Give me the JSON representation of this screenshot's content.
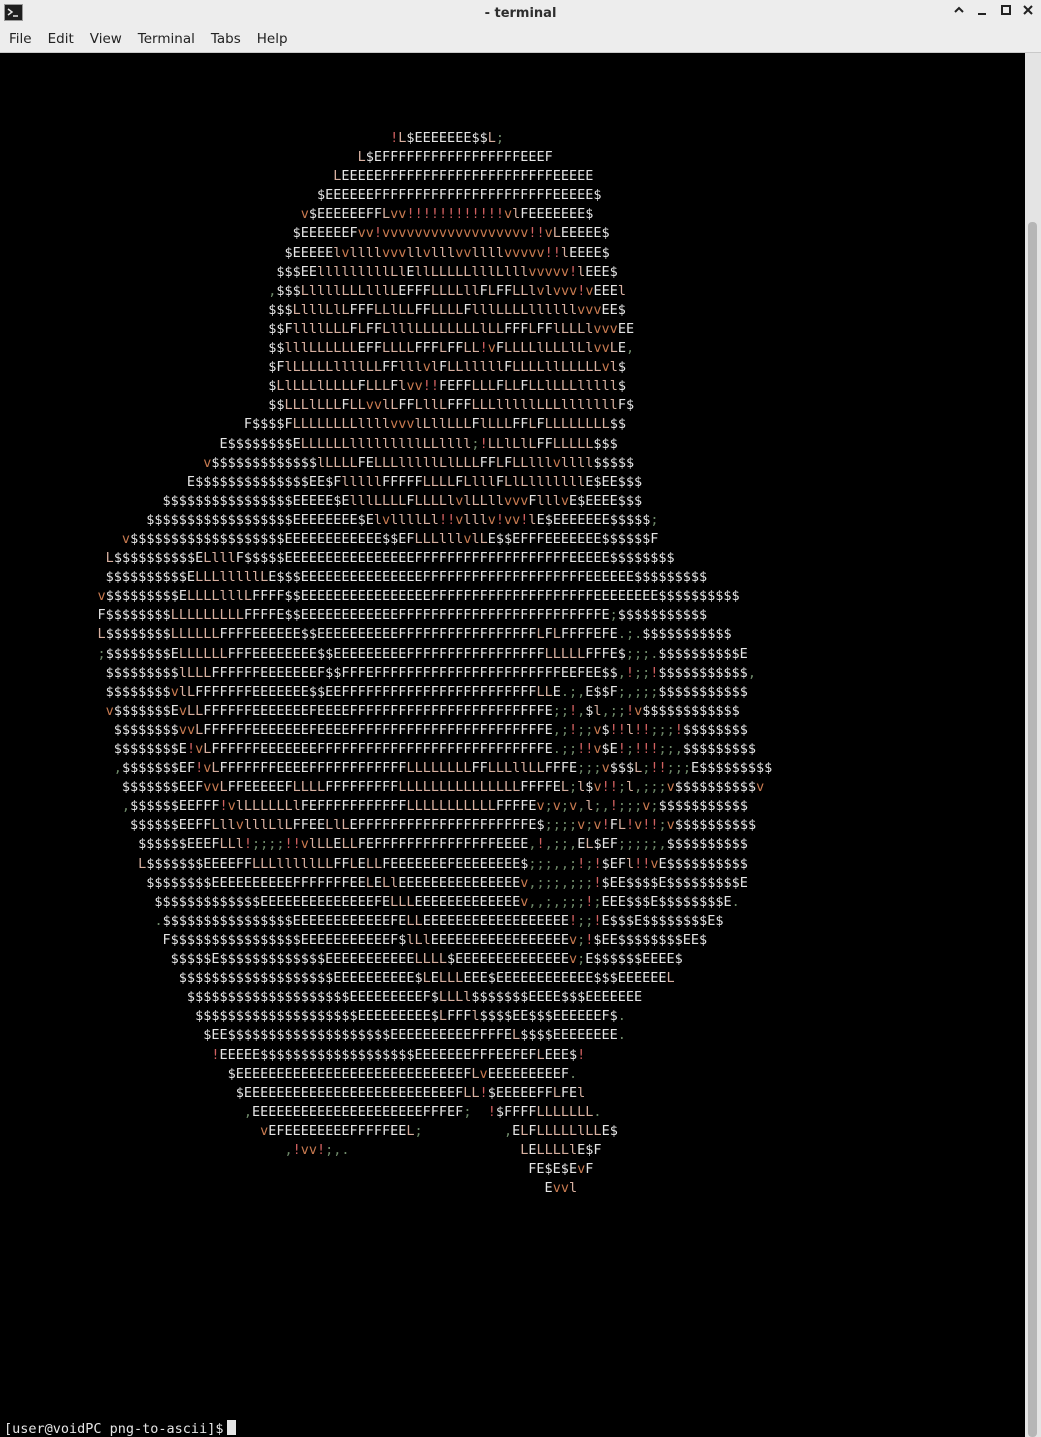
{
  "window": {
    "title": "- terminal"
  },
  "icons": {
    "app": "terminal-icon",
    "minimize": "chevron-up-icon",
    "restore": "minus-icon",
    "maximize": "square-icon",
    "close": "close-icon"
  },
  "menubar": [
    {
      "label": "File"
    },
    {
      "label": "Edit"
    },
    {
      "label": "View"
    },
    {
      "label": "Terminal"
    },
    {
      "label": "Tabs"
    },
    {
      "label": "Help"
    }
  ],
  "terminal": {
    "prompt": "[user@voidPC png-to-ascii]$",
    "art_lines": [
      "                                                !L$EEEEEEE$$L;",
      "                                            L$EFFFFFFFFFFFFFFFFFEEEF",
      "                                         LEEEEEFFFFFFFFFFFFFFFFFFFFFEEEEE",
      "                                       $EEEEEEFFFFFFFFFFFFFFFFFFFFFFEEEEE$",
      "                                     v$EEEEEEFFLvv!!!!!!!!!!!!vlFEEEEEEE$",
      "                                    $EEEEEEFvv!vvvvvvvvvvvvvvvvvv!!vLEEEEE$",
      "                                   $EEEEElvllllvvvllvlllvvllllvvvvv!!lEEEE$",
      "                                  $$$EElllllllllLlEllLLLLLlllLlllvvvvv!lEEE$",
      "                                 ,$$$LllllLLLlllLEFFFLLLLllFLFFLLlvlvvv!vEEEl",
      "                                 $$$LlllLlLFFFLLlLLFFLLLLFlllLLLLllllllvvvEE$",
      "                                 $$FllllLLLFLFFLlllLLLLLLLLlLLFFFLFFlLLLlvvvEE",
      "                                 $$lllLLLLLLEFFLLLLFFFLFFLL!vFLLLLlLLLlLlvvLE,",
      "                                 $FlLLLLLllllLLFFlllvlFLLlllllFLLLLllLLLLLvl$",
      "                                 $LlLLLlLLLLFLLLFlvv!!FEFFLLLFLLFLLlLLLlllll$",
      "                                 $$LLLlLLLFLLvvlLFFLllLFFFLLLlllllLLLlllllllF$",
      "                              F$$$$FLLLLLLLLllllvvvlLllLLLFlLLLFFLFLLLLLLLL$$",
      "                           E$$$$$$$$ELLLLLLlllllllllLLllll;!LLlLlLFFLLLLL$$$",
      "                         v$$$$$$$$$$$$$lLLLLFELLLlllllLlLLLFFLFLLlllvllll$$$$$",
      "                       E$$$$$$$$$$$$$$EE$FlllllFFFFFLLLLFLlllFLlLlllllllE$EE$$$",
      "                    $$$$$$$$$$$$$$$$EEEEE$ElllLLLLFLLLLlvlLLllvvvFlllvE$EEEE$$$",
      "                  $$$$$$$$$$$$$$$$$$EEEEEEEE$ElvllllLl!!vlllv!vv!lE$EEEEEEE$$$$$;",
      "               v$$$$$$$$$$$$$$$$$$$EEEEEEEEEEEE$$EFLLLlllvlLE$$EFFFEEEEEEE$$$$$$F",
      "             L$$$$$$$$$$ELlllF$$$$$EEEEEEEEEEEEEEEEFFFFFFFFFFFFFFFFFFFEEEEE$$$$$$$$",
      "             $$$$$$$$$$ELLLlllllLE$$$EEEEEEEEEEEEEEEFFFFFFFFFFFFFFFFFFFFEEEEEE$$$$$$$$$",
      "            v$$$$$$$$$ELLLLlllLFFFF$$EEEEEEEEEEEEEEEEFFFFFFFFFFFFFFFFFFFFEEEEEEEE$$$$$$$$$$",
      "            F$$$$$$$$LLLLLLLLLFFFFE$$EEEEEEEEEEEEFFFFFFFFFFFFFFFFFFFFFFFFFE;$$$$$$$$$$$",
      "            L$$$$$$$$LLLLLLFFFFEEEEEE$$EEEEEEEEEEFFFFFFFFFFFFFFFFFLFLFFFFEFE.;.$$$$$$$$$$$",
      "            ;$$$$$$$$ELLLLLLFFFEEEEEEEE$$EEEEEEEEEFFFFFFFFFFFFFFFFFLLLLLFFFE$;;;.$$$$$$$$$$E",
      "             $$$$$$$$$lLLLFFFFFFEEEEEEEF$$FFFEFFFFFFFFFFFFFFFFFFFFFFFEEFEE$$,!;;!$$$$$$$$$$$,",
      "             $$$$$$$$vlLFFFFFFFEEEEEEE$$EEFFFFFFFFFFFFFFFFFFFFFFFFLLE.;,E$$F;,;;;$$$$$$$$$$$",
      "             v$$$$$$$EvLLFFFFFFEEEEEEEFEEEEFFFFFFFFFFFFFFFFFFFFFFFFE;;!,$l,;;!v$$$$$$$$$$$$",
      "              $$$$$$$$vvLFFFFFFEEEEEEEFEEEEFFFFFFFFFFFFFFFFFFFFFFFFE,;!;;v$!!l!!;;;!$$$$$$$$",
      "              $$$$$$$$E!vLFFFFFFEEEEEEEFFFFFFFFFFFFFFFFFFFFFFFFFFFFE.;;!!v$E!;!!!;;,$$$$$$$$$",
      "              ,$$$$$$$EF!vLFFFFFFFEEEEFFFFFFFFFFFFLLLLLLLLFFLLLllLLFFFE;;;v$$$L;!!;;;E$$$$$$$$$",
      "               $$$$$$$EEFvvLFFEEEEEFLLLLFFFFFFFFFLLLLLLLLLLLLLLLFFFFEL;l$v!!;l,;;;v$$$$$$$$$$v",
      "               ,$$$$$$EEFFF!vlLLLLLLlFEFFFFFFFFFFFLLLLLLLLLLLFFFFEv;v;v,l;,!;;;v;$$$$$$$$$$$",
      "                $$$$$$EEFFLllvlllLlLFFEELlLEFFFFFFFFFFFFFFFFFFFFFE$;;;;v;v!FL!v!!;v$$$$$$$$$$",
      "                 $$$$$$EEEFLLl!;;;;!!vlLLELLFEFFFFFFFFFFFFFFFEEEE,!,;;,EL$EF;;;;;,$$$$$$$$$$",
      "                 L$$$$$$$EEEEFFLLLlllllLLFFLELLFEEEEEEEFEEEEEEEE$;;;,,;!;!$EFl!!vE$$$$$$$$$$",
      "                  $$$$$$$$EEEEEEEEEEFFFFFFFEELELlEEEEEEEEEEEEEEEv,;;;,;;;!$EE$$$$E$$$$$$$$$E",
      "                   $$$$$$$$$$$$$EEEEEEEEEEEEEEFELLLEEEEEEEEEEEEEv,,;,;;;!;EEE$$$E$$$$$$$$E.",
      "                   .$$$$$$$$$$$$$$$$EEEEEEEEEEEEFELLEEEEEEEEEEEEEEEEEE!;;!E$$$E$$$$$$$$E$",
      "                    F$$$$$$$$$$$$$$$$EEEEEEEEEEEF$lLlEEEEEEEEEEEEEEEEEv;!$EE$$$$$$$$EE$",
      "                     $$$$$E$$$$$$$$$$$$$EEEEEEEEEEELLLL$EEEEEEEEEEEEEEv;E$$$$$$EEEE$",
      "                      $$$$$$$$$$$$$$$$$$$EEEEEEEEEE$LELLLEEE$EEEEEEEEEEEE$$$EEEEEEL",
      "                       $$$$$$$$$$$$$$$$$$$$EEEEEEEEEF$LLLl$$$$$$$EEEE$$$EEEEEEE",
      "                        $$$$$$$$$$$$$$$$$$$$EEEEEEEEE$LFFFl$$$$EE$$$EEEEEEF$.",
      "                         $EE$$$$$$$$$$$$$$$$$$$$EEEEEEEEEEFFFFEL$$$$EEEEEEEE.",
      "                          !EEEEE$$$$$$$$$$$$$$$$$$$EEEEEEEFFFEEFEFLEEE$!",
      "                            $EEEEEEEEEEEEEEEEEEEEEEEEEEEEFLvEEEEEEEEEF.",
      "                             $EEEEEEEEEEEEEEEEEEEEEEEEEEFLL!$EEEEEFFLFEl",
      "                              ,EEEEEEEEEEEEEEEEEEEEEFFFEF;  !$FFFFLLLLLLL.",
      "                                vEFEEEEEEEEFFFFFEEL;          ,ELFLLLLLlLLE$",
      "                                   ,!vv!;,.                     LELLLLlE$F",
      "                                                                 FE$E$EvF",
      "                                                                   Evvl"
    ]
  }
}
